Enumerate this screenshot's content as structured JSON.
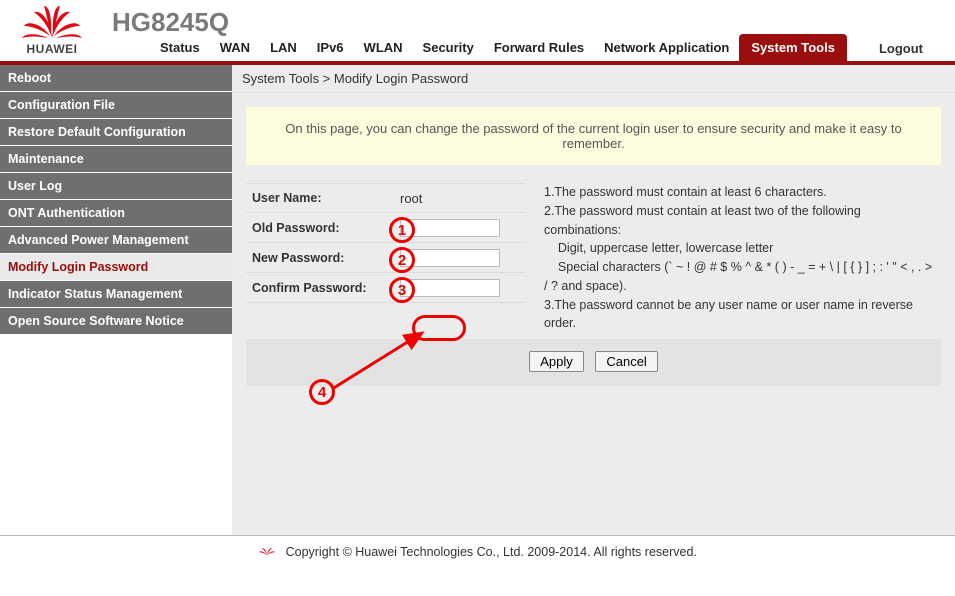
{
  "header": {
    "brand": "HUAWEI",
    "model": "HG8245Q",
    "logout": "Logout"
  },
  "tabs": [
    {
      "label": "Status"
    },
    {
      "label": "WAN"
    },
    {
      "label": "LAN"
    },
    {
      "label": "IPv6"
    },
    {
      "label": "WLAN"
    },
    {
      "label": "Security"
    },
    {
      "label": "Forward Rules"
    },
    {
      "label": "Network Application"
    },
    {
      "label": "System Tools",
      "active": true
    }
  ],
  "sidebar": [
    {
      "label": "Reboot"
    },
    {
      "label": "Configuration File"
    },
    {
      "label": "Restore Default Configuration"
    },
    {
      "label": "Maintenance"
    },
    {
      "label": "User Log"
    },
    {
      "label": "ONT Authentication"
    },
    {
      "label": "Advanced Power Management"
    },
    {
      "label": "Modify Login Password",
      "active": true
    },
    {
      "label": "Indicator Status Management"
    },
    {
      "label": "Open Source Software Notice"
    }
  ],
  "breadcrumb": "System Tools > Modify Login Password",
  "notice": "On this page, you can change the password of the current login user to ensure security and make it easy to remember.",
  "form": {
    "username_label": "User Name:",
    "username_value": "root",
    "old_pw_label": "Old Password:",
    "new_pw_label": "New Password:",
    "confirm_pw_label": "Confirm Password:"
  },
  "rules_text": "1.The password must contain at least 6 characters.\n2.The password must contain at least two of the following combinations:\n    Digit, uppercase letter, lowercase letter\n    Special characters (` ~ ! @ # $ % ^ & * ( ) - _ = + \\ | [ { } ] ; : ' \" < , . > / ? and space).\n3.The password cannot be any user name or user name in reverse order.",
  "buttons": {
    "apply": "Apply",
    "cancel": "Cancel"
  },
  "callouts": {
    "c1": "1",
    "c2": "2",
    "c3": "3",
    "c4": "4"
  },
  "footer": "Copyright © Huawei Technologies Co., Ltd. 2009-2014. All rights reserved."
}
